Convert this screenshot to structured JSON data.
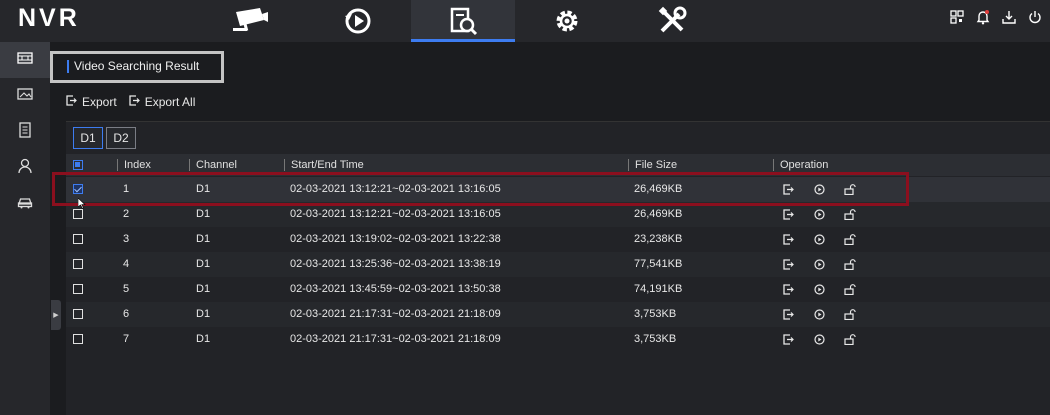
{
  "app": {
    "logo": "NVR"
  },
  "nav": {
    "tabs": [
      {
        "icon": "camera-icon"
      },
      {
        "icon": "playback-icon"
      },
      {
        "icon": "search-icon",
        "active": true
      },
      {
        "icon": "gear-icon"
      },
      {
        "icon": "tools-icon"
      }
    ],
    "right_icons": [
      "qr-code-icon",
      "bell-icon",
      "download-icon",
      "power-icon"
    ]
  },
  "sidebar": {
    "items": [
      {
        "icon": "video-icon",
        "active": true
      },
      {
        "icon": "image-icon"
      },
      {
        "icon": "document-icon"
      },
      {
        "icon": "person-icon"
      },
      {
        "icon": "car-icon"
      }
    ]
  },
  "page": {
    "title": "Video Searching Result",
    "export_label": "Export",
    "export_all_label": "Export All"
  },
  "device_tabs": [
    "D1",
    "D2"
  ],
  "table": {
    "columns": [
      "Index",
      "Channel",
      "Start/End Time",
      "File Size",
      "Operation"
    ],
    "rows": [
      {
        "index": "1",
        "channel": "D1",
        "time": "02-03-2021 13:12:21~02-03-2021 13:16:05",
        "size": "26,469KB",
        "checked": true
      },
      {
        "index": "2",
        "channel": "D1",
        "time": "02-03-2021 13:12:21~02-03-2021 13:16:05",
        "size": "26,469KB",
        "checked": false
      },
      {
        "index": "3",
        "channel": "D1",
        "time": "02-03-2021 13:19:02~02-03-2021 13:22:38",
        "size": "23,238KB",
        "checked": false
      },
      {
        "index": "4",
        "channel": "D1",
        "time": "02-03-2021 13:25:36~02-03-2021 13:38:19",
        "size": "77,541KB",
        "checked": false
      },
      {
        "index": "5",
        "channel": "D1",
        "time": "02-03-2021 13:45:59~02-03-2021 13:50:38",
        "size": "74,191KB",
        "checked": false
      },
      {
        "index": "6",
        "channel": "D1",
        "time": "02-03-2021 21:17:31~02-03-2021 21:18:09",
        "size": "3,753KB",
        "checked": false
      },
      {
        "index": "7",
        "channel": "D1",
        "time": "02-03-2021 21:17:31~02-03-2021 21:18:09",
        "size": "3,753KB",
        "checked": false
      }
    ],
    "row_actions": [
      "export-icon",
      "play-icon",
      "lock-icon"
    ]
  },
  "colors": {
    "accent": "#3d7cf0",
    "highlight": "#8b0f1e",
    "background": "#1b1c1f"
  }
}
